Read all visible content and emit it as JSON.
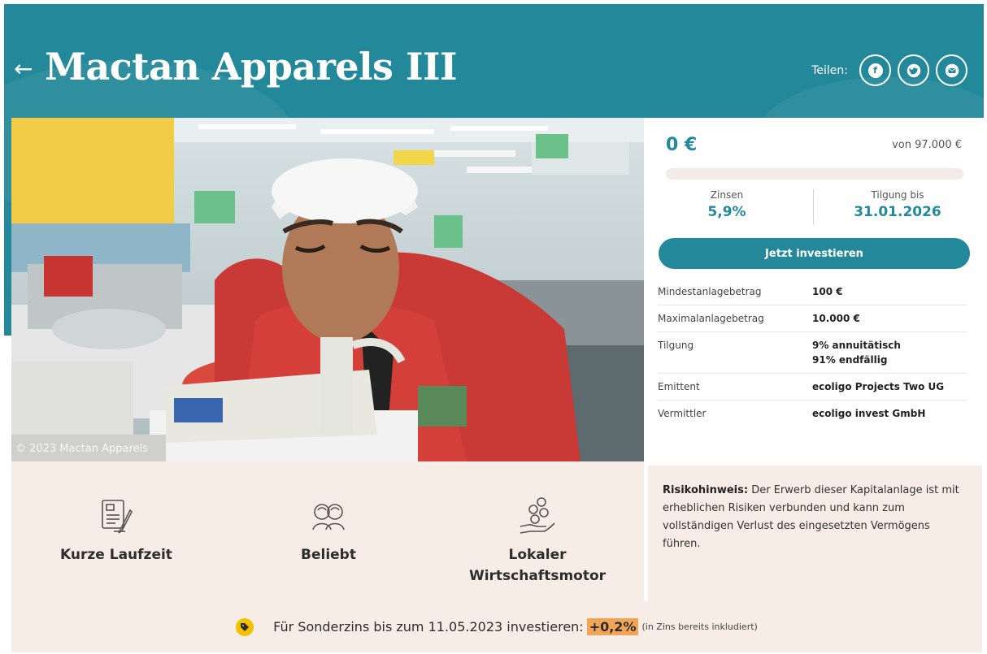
{
  "header": {
    "back_icon": "arrow-left-icon",
    "title": "Mactan Apparels III",
    "share_label": "Teilen:",
    "share_icons": [
      "facebook-icon",
      "twitter-icon",
      "mail-icon"
    ],
    "color": "#23899a"
  },
  "photo": {
    "credit": "© 2023 Mactan Apparels"
  },
  "funding": {
    "amount": "0 €",
    "of_total": "von 97.000 €",
    "progress_fraction": 0,
    "interest_label": "Zinsen",
    "interest_value": "5,9%",
    "repayment_label": "Tilgung bis",
    "repayment_value": "31.01.2026",
    "cta": "Jetzt investieren"
  },
  "details": [
    {
      "key": "Mindestanlagebetrag",
      "value": "100 €"
    },
    {
      "key": "Maximalanlagebetrag",
      "value": "10.000 €"
    },
    {
      "key": "Tilgung",
      "value": "9% annuitätisch",
      "value2": "91% endfällig"
    },
    {
      "key": "Emittent",
      "value": "ecoligo Projects Two UG"
    },
    {
      "key": "Vermittler",
      "value": "ecoligo invest GmbH"
    }
  ],
  "features": [
    {
      "icon": "document-pen-icon",
      "label": "Kurze Laufzeit"
    },
    {
      "icon": "people-icon",
      "label": "Beliebt"
    },
    {
      "icon": "coins-hand-icon",
      "label": "Lokaler Wirtschaftsmotor"
    }
  ],
  "risk": {
    "title": "Risikohinweis:",
    "text": "Der Erwerb dieser Kapitalanlage ist mit erheblichen Risiken verbunden und kann zum vollständigen Verlust des eingesetzten Vermögens führen."
  },
  "banner": {
    "icon": "tag-icon",
    "text": "Für Sonderzins bis zum 11.05.2023 investieren:",
    "bonus": "+0,2%",
    "note": "(in Zins bereits inkludiert)",
    "highlight_color": "#f2a556"
  }
}
